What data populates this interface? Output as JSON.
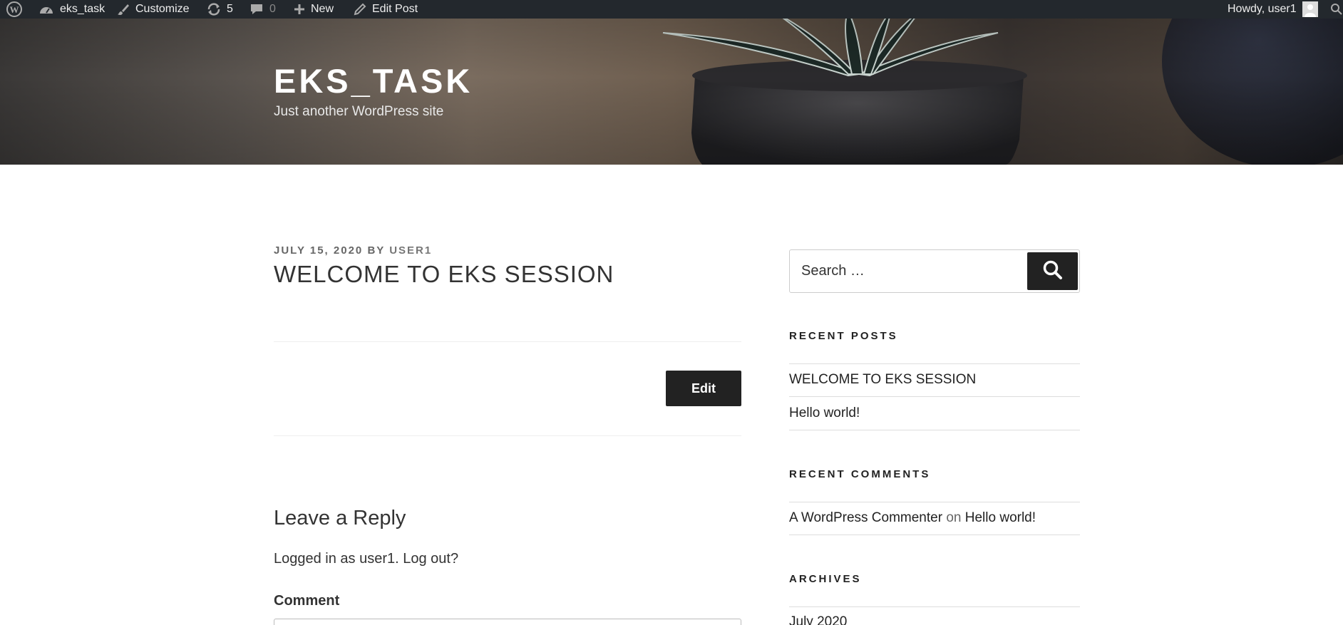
{
  "admin_bar": {
    "site_name": "eks_task",
    "customize": "Customize",
    "updates_count": "5",
    "comments_count": "0",
    "new_label": "New",
    "edit_post": "Edit Post",
    "howdy": "Howdy, user1"
  },
  "header": {
    "site_title": "EKS_TASK",
    "tagline": "Just another WordPress site"
  },
  "post": {
    "date": "JULY 15, 2020",
    "by": "BY",
    "author": "USER1",
    "title": "WELCOME TO EKS SESSION",
    "edit_button": "Edit"
  },
  "reply": {
    "title": "Leave a Reply",
    "logged_in": "Logged in as user1. Log out?",
    "comment_label": "Comment"
  },
  "sidebar": {
    "search_placeholder": "Search …",
    "recent_posts_title": "RECENT POSTS",
    "recent_posts": [
      "WELCOME TO EKS SESSION",
      "Hello world!"
    ],
    "recent_comments_title": "RECENT COMMENTS",
    "recent_comment": {
      "author": "A WordPress Commenter",
      "on": "on",
      "post": "Hello world!"
    },
    "archives_title": "ARCHIVES",
    "archives": [
      "July 2020"
    ]
  },
  "colors": {
    "admin_bar_bg": "#23282d",
    "button_bg": "#222222",
    "text": "#333333"
  }
}
